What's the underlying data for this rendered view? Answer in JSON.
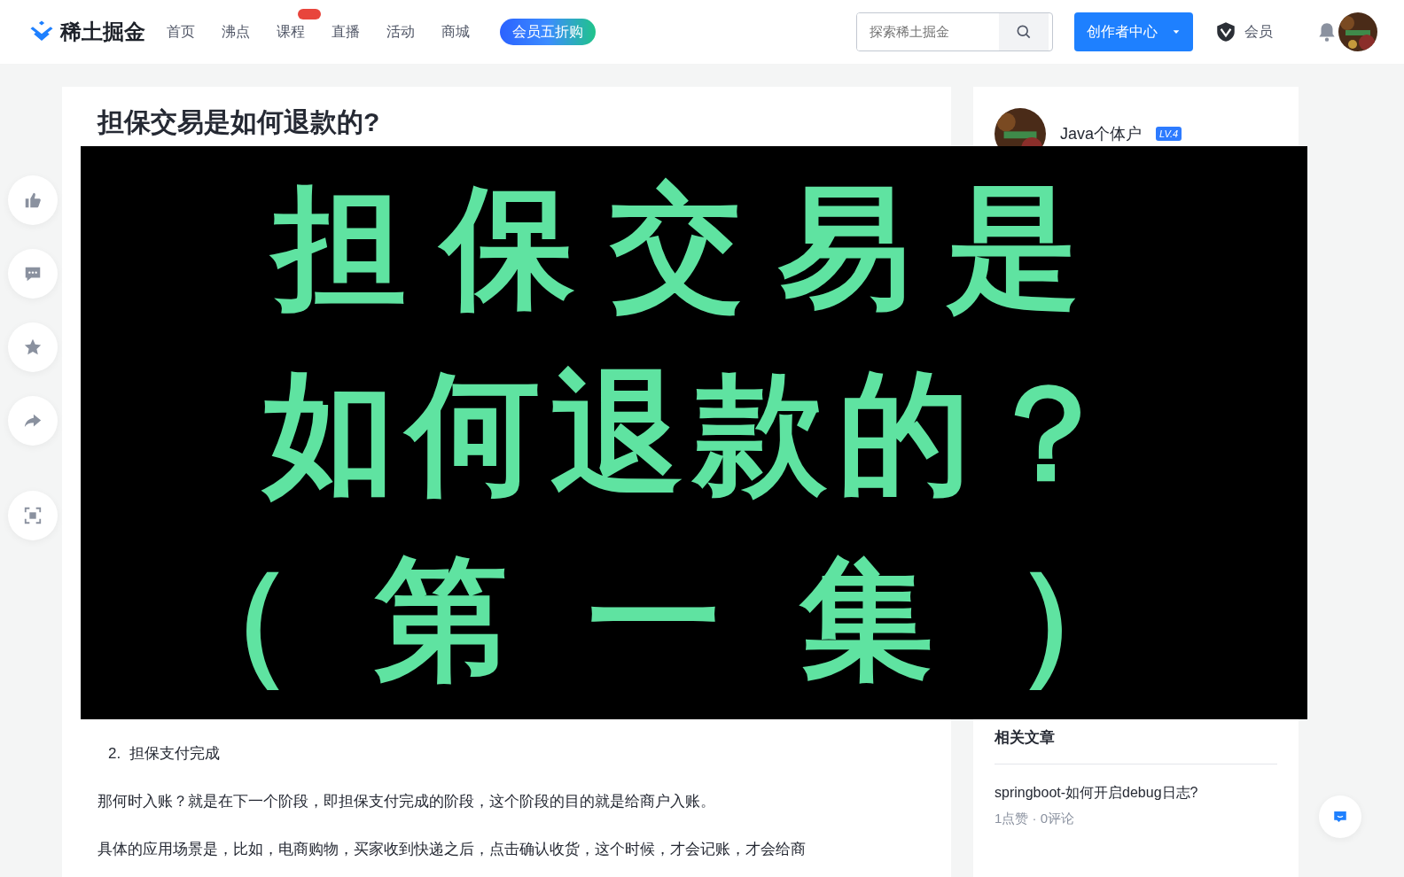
{
  "header": {
    "logo": "稀土掘金",
    "nav": [
      {
        "label": "首页",
        "selected": false,
        "badge": false
      },
      {
        "label": "沸点",
        "selected": false,
        "badge": false
      },
      {
        "label": "课程",
        "selected": false,
        "badge": true
      },
      {
        "label": "直播",
        "selected": false,
        "badge": false
      },
      {
        "label": "活动",
        "selected": false,
        "badge": false
      },
      {
        "label": "商城",
        "selected": false,
        "badge": false
      }
    ],
    "promo_button": "会员五折购",
    "search": {
      "placeholder": "探索稀土掘金"
    },
    "creator_button": "创作者中心",
    "member_label": "会员"
  },
  "side_actions": [
    {
      "kind": "like"
    },
    {
      "kind": "comment"
    },
    {
      "kind": "star"
    },
    {
      "kind": "share"
    },
    {
      "kind": "screenshot"
    }
  ],
  "article": {
    "title": "担保交易是如何退款的?",
    "sections": [
      {
        "kind": "list_item",
        "number": "2.",
        "text": "担保支付完成"
      },
      {
        "kind": "paragraph",
        "text": "那何时入账？就是在下一个阶段，即担保支付完成的阶段，这个阶段的目的就是给商户入账。"
      },
      {
        "kind": "paragraph",
        "text": "具体的应用场景是，比如，电商购物，买家收到快递之后，点击确认收货，这个时候，才会记账，才会给商"
      }
    ]
  },
  "overlay": {
    "lines": [
      "担保交易是",
      "如何退款的？",
      "（第一集）"
    ]
  },
  "author": {
    "name": "Java个体户",
    "level": "LV.4"
  },
  "related": {
    "title": "相关文章",
    "items": [
      {
        "title": "springboot-如何开启debug日志?",
        "meta": "1点赞 · 0评论"
      }
    ]
  }
}
